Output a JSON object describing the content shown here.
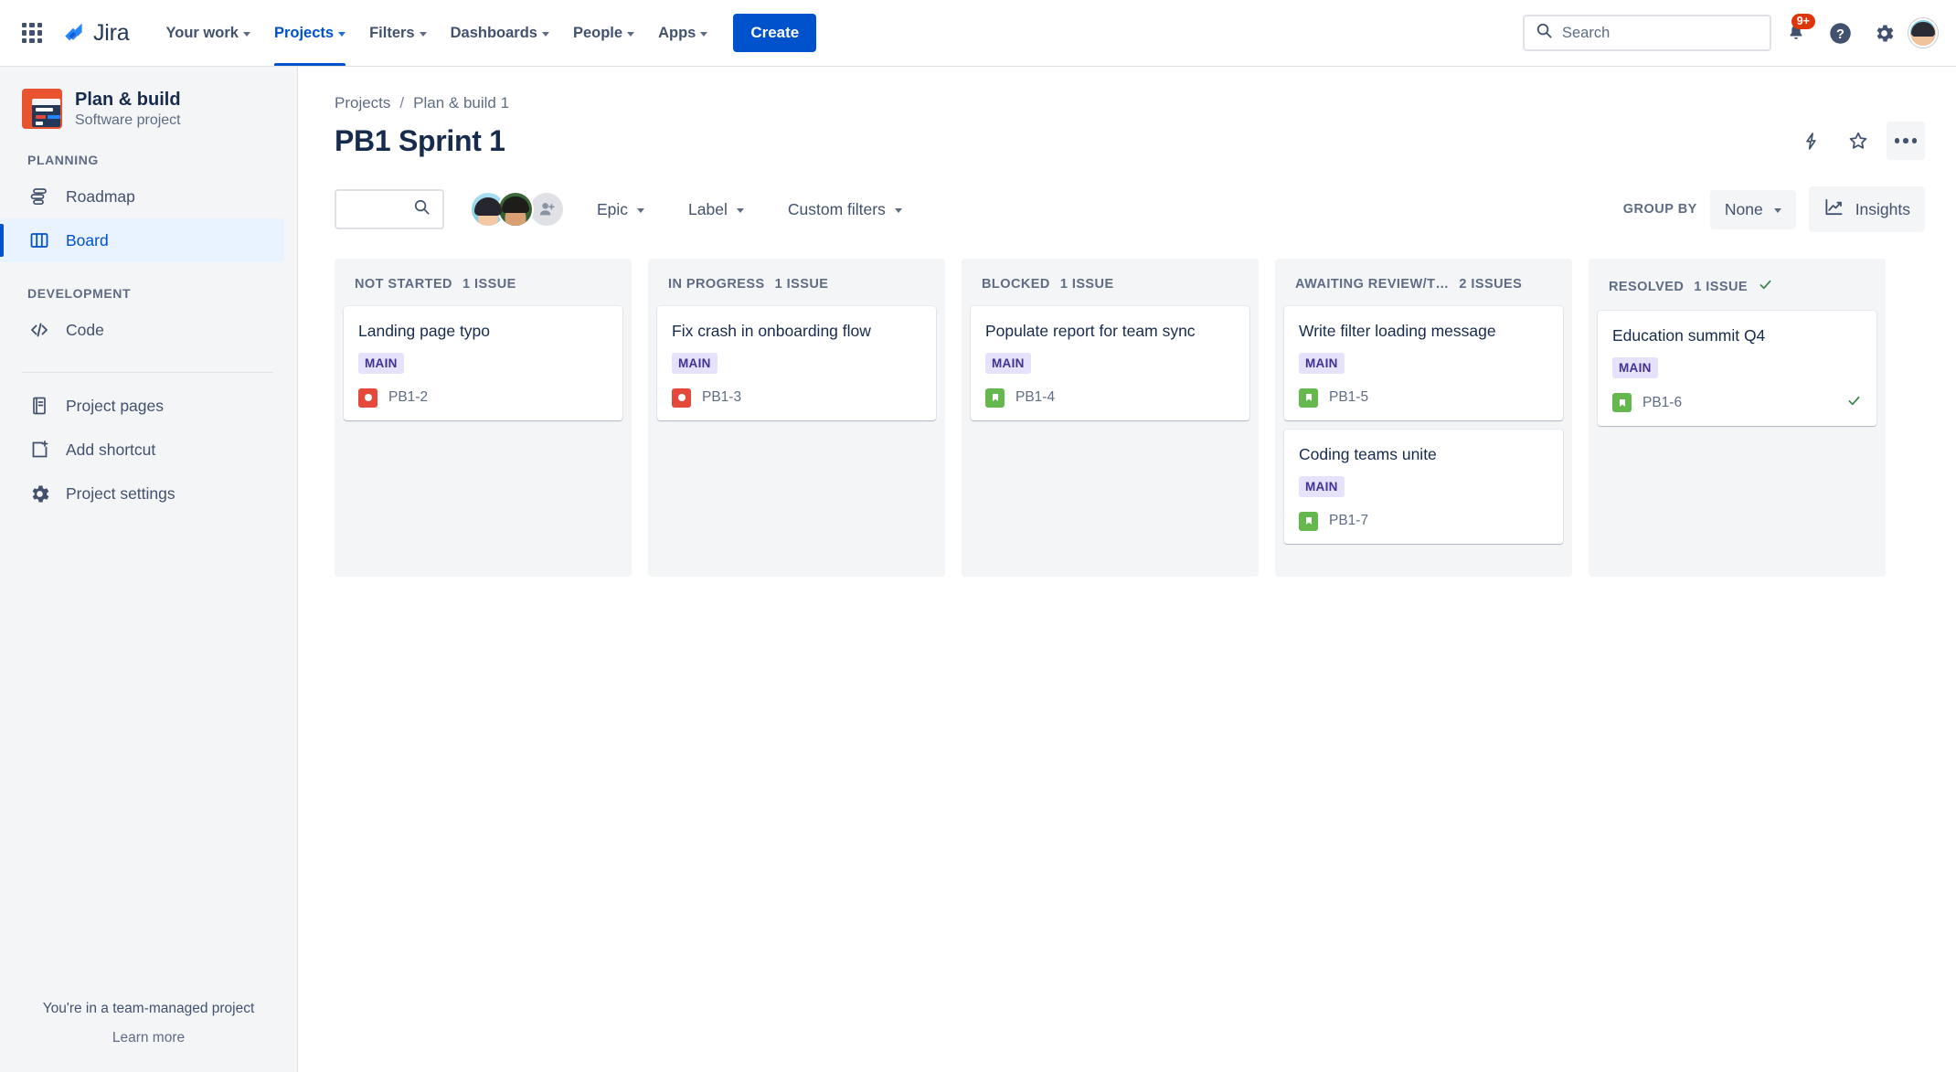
{
  "topnav": {
    "app_switcher": "app-switcher-icon",
    "brand": "Jira",
    "items": [
      {
        "label": "Your work",
        "has_chevron": true,
        "active": false
      },
      {
        "label": "Projects",
        "has_chevron": true,
        "active": true
      },
      {
        "label": "Filters",
        "has_chevron": true,
        "active": false
      },
      {
        "label": "Dashboards",
        "has_chevron": true,
        "active": false
      },
      {
        "label": "People",
        "has_chevron": true,
        "active": false
      },
      {
        "label": "Apps",
        "has_chevron": true,
        "active": false
      }
    ],
    "create_label": "Create",
    "search_placeholder": "Search",
    "notification_badge": "9+"
  },
  "sidebar": {
    "project_name": "Plan & build",
    "project_type": "Software project",
    "sections": [
      {
        "label": "PLANNING",
        "items": [
          {
            "label": "Roadmap",
            "icon": "roadmap-icon",
            "selected": false
          },
          {
            "label": "Board",
            "icon": "board-icon",
            "selected": true
          }
        ]
      },
      {
        "label": "DEVELOPMENT",
        "items": [
          {
            "label": "Code",
            "icon": "code-icon",
            "selected": false
          }
        ]
      }
    ],
    "extra_items": [
      {
        "label": "Project pages",
        "icon": "pages-icon"
      },
      {
        "label": "Add shortcut",
        "icon": "add-shortcut-icon"
      },
      {
        "label": "Project settings",
        "icon": "gear-icon"
      }
    ],
    "footer_line1": "You're in a team-managed project",
    "footer_line2": "Learn more"
  },
  "header": {
    "breadcrumb": [
      "Projects",
      "Plan & build 1"
    ],
    "breadcrumb_separator": "/",
    "title": "PB1 Sprint 1",
    "actions": [
      {
        "name": "lightning-icon"
      },
      {
        "name": "star-icon"
      },
      {
        "name": "more-actions-icon"
      }
    ]
  },
  "filterbar": {
    "search_value": "",
    "search_placeholder": "",
    "dropdowns": [
      {
        "label": "Epic"
      },
      {
        "label": "Label"
      },
      {
        "label": "Custom filters"
      }
    ],
    "group_by_label": "GROUP BY",
    "group_by_value": "None",
    "insights_label": "Insights"
  },
  "board": {
    "columns": [
      {
        "name": "NOT STARTED",
        "count": "1 ISSUE",
        "done": false,
        "cards": [
          {
            "title": "Landing page typo",
            "epic": "MAIN",
            "key": "PB1-2",
            "type": "bug",
            "resolved": false
          }
        ]
      },
      {
        "name": "IN PROGRESS",
        "count": "1 ISSUE",
        "done": false,
        "cards": [
          {
            "title": "Fix crash in onboarding flow",
            "epic": "MAIN",
            "key": "PB1-3",
            "type": "bug",
            "resolved": false
          }
        ]
      },
      {
        "name": "BLOCKED",
        "count": "1 ISSUE",
        "done": false,
        "cards": [
          {
            "title": "Populate report for team sync",
            "epic": "MAIN",
            "key": "PB1-4",
            "type": "story",
            "resolved": false
          }
        ]
      },
      {
        "name": "AWAITING REVIEW/T…",
        "count": "2 ISSUES",
        "done": false,
        "cards": [
          {
            "title": "Write filter loading message",
            "epic": "MAIN",
            "key": "PB1-5",
            "type": "story",
            "resolved": false
          },
          {
            "title": "Coding teams unite",
            "epic": "MAIN",
            "key": "PB1-7",
            "type": "story",
            "resolved": false
          }
        ]
      },
      {
        "name": "RESOLVED",
        "count": "1 ISSUE",
        "done": true,
        "cards": [
          {
            "title": "Education summit Q4",
            "epic": "MAIN",
            "key": "PB1-6",
            "type": "story",
            "resolved": true
          }
        ]
      }
    ]
  },
  "colors": {
    "brand_blue": "#0052cc",
    "epic_bg": "#e6e2fb",
    "epic_text": "#403294",
    "bug_red": "#e5493a",
    "story_green": "#65b84d",
    "done_green": "#36834a",
    "badge_red": "#de350b",
    "sidebar_bg": "#f4f5f7",
    "text_primary": "#172b4d",
    "text_muted": "#5e6c84"
  }
}
